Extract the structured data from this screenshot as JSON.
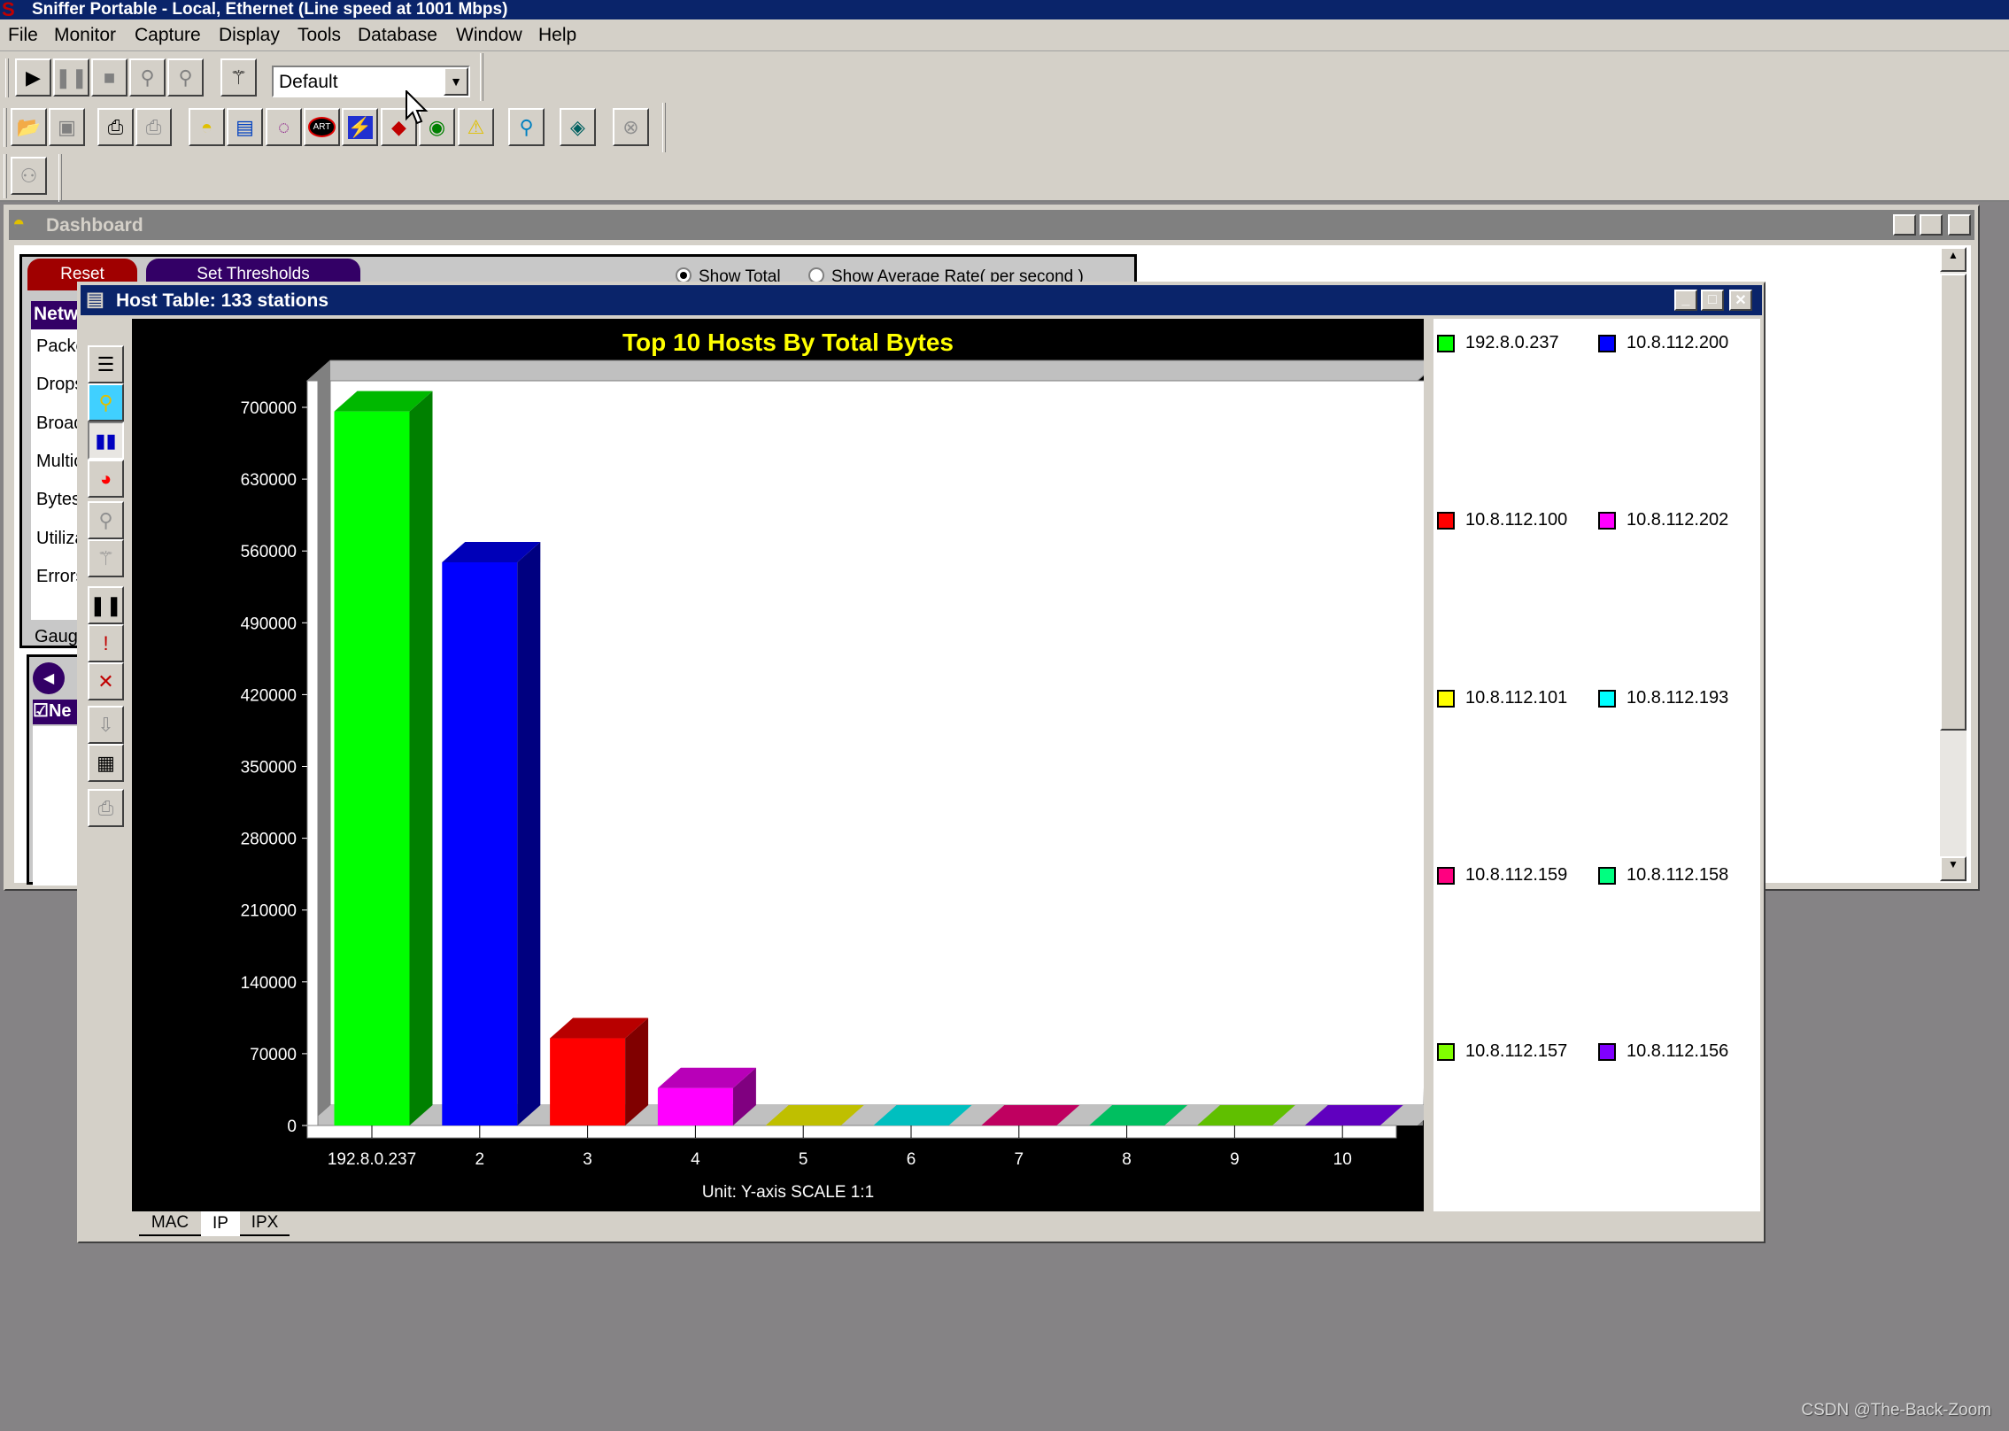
{
  "app": {
    "title": "Sniffer Portable - Local, Ethernet (Line speed at 1001 Mbps)",
    "menu": [
      "File",
      "Monitor",
      "Capture",
      "Display",
      "Tools",
      "Database",
      "Window",
      "Help"
    ],
    "profile_select": {
      "value": "Default"
    },
    "toolbar_icons": [
      "start-capture-icon",
      "pause-icon",
      "stop-icon",
      "stop-and-display-icon",
      "display-icon",
      "wizard-icon"
    ],
    "toolbar2_icons": [
      "open-icon",
      "save-icon",
      "print-icon",
      "print-setup-icon",
      "dashboard-icon",
      "host-table-icon",
      "matrix-icon",
      "art-icon",
      "history-samples-icon",
      "protocol-distribution-icon",
      "global-statistics-icon",
      "alarm-log-icon",
      "define-filter-icon",
      "select-filter-icon",
      "expert-icon"
    ]
  },
  "dashboard": {
    "title": "Dashboard",
    "reset_label": "Reset",
    "thresholds_label": "Set Thresholds",
    "show_total_label": "Show Total",
    "show_average_label": "Show Average Rate( per second )",
    "show_mode": "total",
    "list_header": "Netw",
    "stats": [
      "Packe",
      "Drops",
      "Broad",
      "Multica",
      "Bytes",
      "Utilizat",
      "Errors"
    ],
    "gauge_label": "Gauge",
    "lower_header": "Ne"
  },
  "host_table": {
    "title": "Host Table: 133 stations",
    "tabs": [
      "MAC",
      "IP",
      "IPX"
    ],
    "active_tab": "IP"
  },
  "chart_data": {
    "type": "bar",
    "title": "Top 10 Hosts By Total Bytes",
    "footer": "Unit:  Y-axis SCALE 1:1",
    "categories": [
      "192.8.0.237",
      "2",
      "3",
      "4",
      "5",
      "6",
      "7",
      "8",
      "9",
      "10"
    ],
    "values": [
      696000,
      549000,
      85000,
      36500,
      0,
      0,
      0,
      0,
      0,
      0
    ],
    "yticks": [
      "0",
      "70000",
      "140000",
      "210000",
      "280000",
      "350000",
      "420000",
      "490000",
      "560000",
      "630000",
      "700000"
    ],
    "ylim": [
      0,
      700000
    ],
    "grid": false,
    "legend_position": "right",
    "legend": [
      {
        "label": "192.8.0.237",
        "color": "#00ff00"
      },
      {
        "label": "10.8.112.200",
        "color": "#0000ff"
      },
      {
        "label": "10.8.112.100",
        "color": "#ff0000"
      },
      {
        "label": "10.8.112.202",
        "color": "#ff00ff"
      },
      {
        "label": "10.8.112.101",
        "color": "#ffff00"
      },
      {
        "label": "10.8.112.193",
        "color": "#00ffff"
      },
      {
        "label": "10.8.112.159",
        "color": "#ff0080"
      },
      {
        "label": "10.8.112.158",
        "color": "#00ff80"
      },
      {
        "label": "10.8.112.157",
        "color": "#80ff00"
      },
      {
        "label": "10.8.112.156",
        "color": "#8000ff"
      }
    ]
  },
  "watermark": "CSDN @The-Back-Zoom"
}
